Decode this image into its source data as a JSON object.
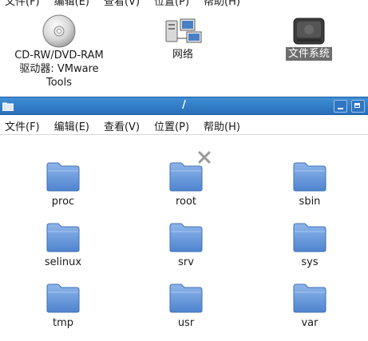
{
  "back_window": {
    "menu": [
      "文件(F)",
      "编辑(E)",
      "查看(V)",
      "位置(P)",
      "帮助(H)"
    ],
    "icons": [
      {
        "label_lines": [
          "CD-RW/DVD-RAM",
          "驱动器: VMware",
          "Tools"
        ],
        "icon": "cd-drive-icon"
      },
      {
        "label": "网络",
        "icon": "network-icon"
      },
      {
        "label": "文件系统",
        "icon": "harddisk-icon",
        "selected": true
      }
    ]
  },
  "front_window": {
    "title": "/",
    "menu": [
      "文件(F)",
      "编辑(E)",
      "查看(V)",
      "位置(P)",
      "帮助(H)"
    ],
    "folders": [
      "proc",
      "root",
      "sbin",
      "selinux",
      "srv",
      "sys",
      "tmp",
      "usr",
      "var"
    ]
  },
  "colors": {
    "titlebar": "#2a6fba",
    "folder": "#5b8fd6",
    "selected_label": "#6d6d6d"
  }
}
